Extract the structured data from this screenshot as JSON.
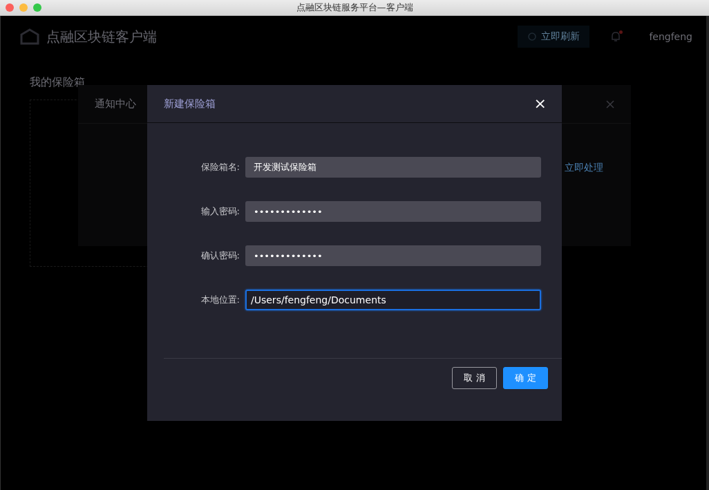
{
  "window": {
    "title": "点融区块链服务平台—客户端"
  },
  "header": {
    "app_name": "点融区块链客户端",
    "refresh_button": "立即刷新",
    "notification_badge": true,
    "user": "fengfeng"
  },
  "page": {
    "title": "我的保险箱"
  },
  "notification_panel": {
    "title": "通知中心",
    "action_link": "立即处理"
  },
  "dialog": {
    "title": "新建保险箱",
    "close": "×",
    "fields": [
      {
        "label": "保险箱名:",
        "value": "开发测试保险箱",
        "focused": false
      },
      {
        "label": "输入密码:",
        "value": "•••••••••••••",
        "focused": false
      },
      {
        "label": "确认密码:",
        "value": "•••••••••••••",
        "focused": false
      },
      {
        "label": "本地位置:",
        "value": "/Users/fengfeng/Documents",
        "focused": true
      }
    ],
    "buttons": [
      {
        "label": "取 消",
        "kind": "secondary"
      },
      {
        "label": "确 定",
        "kind": "primary"
      }
    ]
  }
}
